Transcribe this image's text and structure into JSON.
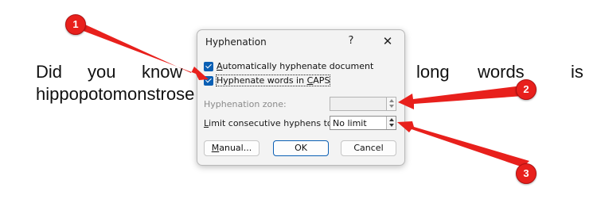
{
  "document": {
    "line1": [
      "Did",
      "you",
      "know",
      "long",
      "words",
      "is"
    ],
    "line2": "hippopotomonstrose"
  },
  "dialog": {
    "title": "Hyphenation",
    "help_label": "?",
    "close_label": "✕",
    "auto_hyphenate": {
      "label_prefix": "",
      "accel": "A",
      "label_rest": "utomatically hyphenate document",
      "checked": true
    },
    "hyphenate_caps": {
      "label_prefix": "Hyphenate words in ",
      "accel": "C",
      "label_rest": "APS",
      "checked": true
    },
    "zone": {
      "label": "Hyphenation zone:",
      "value": "",
      "disabled": true
    },
    "limit": {
      "accel": "L",
      "label_rest": "imit consecutive hyphens to:",
      "value": "No limit"
    },
    "buttons": {
      "manual_accel": "M",
      "manual_rest": "anual...",
      "ok": "OK",
      "cancel": "Cancel"
    }
  },
  "callouts": [
    "1",
    "2",
    "3"
  ],
  "colors": {
    "callout_red": "#e8201c",
    "accent_blue": "#0a5fb4",
    "dialog_bg": "#f3f3f3"
  }
}
